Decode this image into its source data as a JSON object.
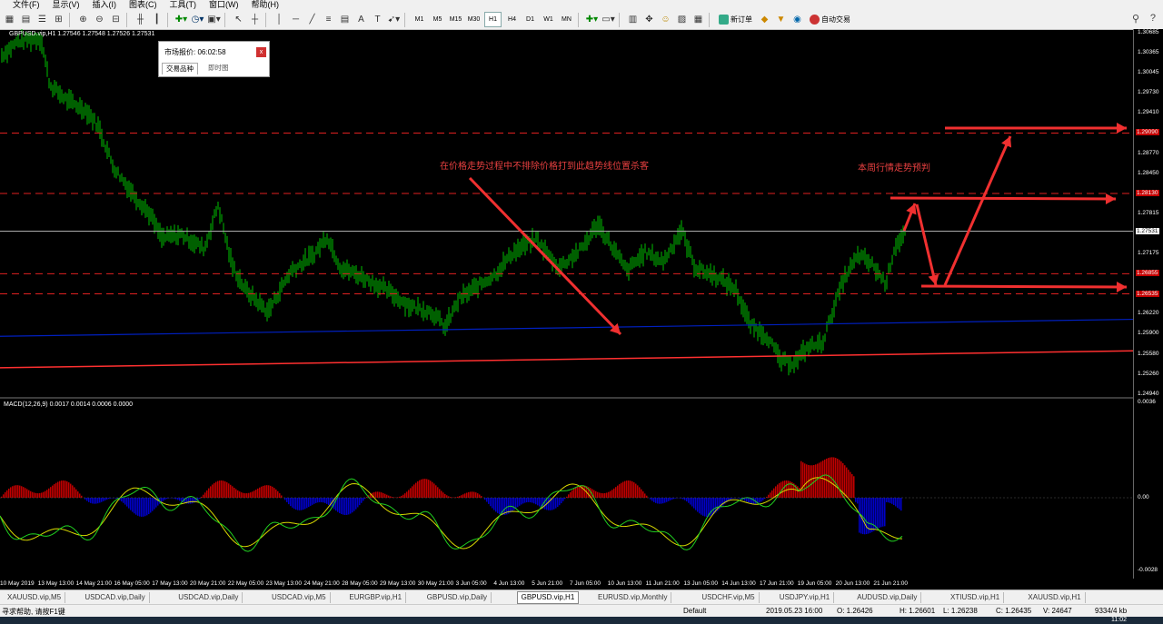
{
  "menu": [
    "文件(F)",
    "显示(V)",
    "插入(I)",
    "图表(C)",
    "工具(T)",
    "窗口(W)",
    "帮助(H)"
  ],
  "toolbar": {
    "timeframes": [
      "M1",
      "M5",
      "M15",
      "M30",
      "H1",
      "H4",
      "D1",
      "W1",
      "MN"
    ],
    "active_timeframe": "H1",
    "new_order_label": "新订单",
    "autotrade_label": "自动交易"
  },
  "chart": {
    "symbol_info": "GBPUSD.vip,H1  1.27546 1.27548 1.27526 1.27531",
    "price_labels": [
      "1.30685",
      "1.30365",
      "1.30045",
      "1.29730",
      "1.29410",
      "1.29090",
      "1.28770",
      "1.28450",
      "1.28130",
      "1.27815",
      "1.27531",
      "1.27175",
      "1.26855",
      "1.26535",
      "1.26220",
      "1.25900",
      "1.25580",
      "1.25260",
      "1.24940"
    ],
    "red_tags": [
      "1.29090",
      "1.28130",
      "1.26855",
      "1.26535"
    ],
    "current_price": "1.27531",
    "macd_label": "MACD(12,26,9) 0.0017 0.0014 0.0006 0.0000",
    "macd_levels": [
      "0.0036",
      "0.00",
      "-0.0028"
    ],
    "time_labels": [
      "10 May 2019",
      "13 May 13:00",
      "14 May 21:00",
      "16 May 05:00",
      "17 May 13:00",
      "20 May 21:00",
      "22 May 05:00",
      "23 May 13:00",
      "24 May 21:00",
      "28 May 05:00",
      "29 May 13:00",
      "30 May 21:00",
      "3 Jun 05:00",
      "4 Jun 13:00",
      "5 Jun 21:00",
      "7 Jun 05:00",
      "10 Jun 13:00",
      "11 Jun 21:00",
      "13 Jun 05:00",
      "14 Jun 13:00",
      "17 Jun 21:00",
      "19 Jun 05:00",
      "20 Jun 13:00",
      "21 Jun 21:00"
    ]
  },
  "popup": {
    "title": "市场报价: 06:02:58",
    "tab1": "交易品种",
    "tab2": "即时图",
    "close": "x"
  },
  "annotations": {
    "left_text": "在价格走势过程中不排除价格打到此趋势线位置杀客",
    "right_text": "本周行情走势预判"
  },
  "symbol_tabs": [
    "XAUUSD.vip,M5",
    "USDCAD.vip,Daily",
    "USDCAD.vip,Daily",
    "USDCAD.vip,M5",
    "EURGBP.vip,H1",
    "GBPUSD.vip,Daily",
    "GBPUSD.vip,H1",
    "EURUSD.vip,Monthly",
    "USDCHF.vip,M5",
    "USDJPY.vip,H1",
    "AUDUSD.vip,Daily",
    "XTIUSD.vip,H1",
    "XAUUSD.vip,H1"
  ],
  "active_tab": "GBPUSD.vip,H1",
  "status": {
    "help": "寻求帮助, 请按F1键",
    "profile": "Default",
    "datetime": "2019.05.23 16:00",
    "open": "O: 1.26426",
    "high": "H: 1.26601",
    "low": "L: 1.26238",
    "close": "C: 1.26435",
    "volume": "V: 24647",
    "traffic": "9334/4 kb"
  },
  "taskbar": {
    "clock": "11:02"
  },
  "colors": {
    "candles": "#00c000",
    "support": "#0020c0",
    "trend": "#ff3030",
    "annotation": "#e84040"
  }
}
